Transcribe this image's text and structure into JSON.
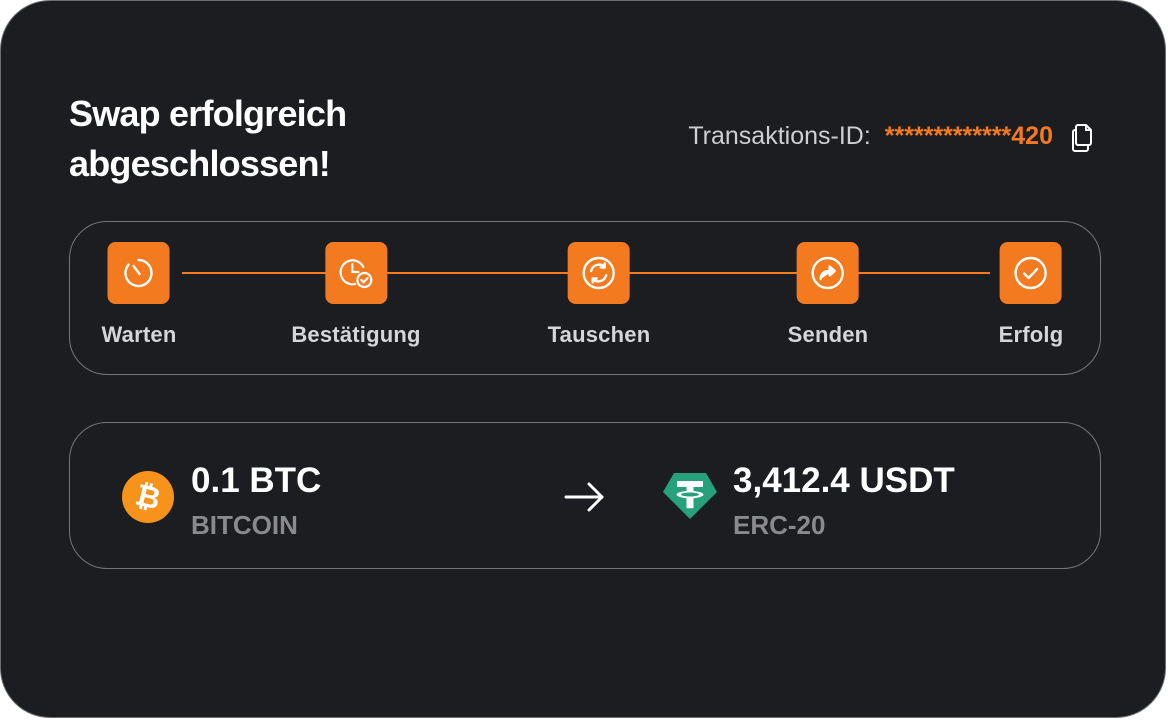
{
  "header": {
    "title_line1": "Swap erfolgreich",
    "title_line2": "abgeschlossen!",
    "transaction_label": "Transaktions-ID:",
    "transaction_id": "*************420"
  },
  "steps": [
    {
      "label": "Warten",
      "icon": "timer-icon"
    },
    {
      "label": "Bestätigung",
      "icon": "clock-check-icon"
    },
    {
      "label": "Tauschen",
      "icon": "swap-cycle-icon"
    },
    {
      "label": "Senden",
      "icon": "forward-arrow-icon"
    },
    {
      "label": "Erfolg",
      "icon": "check-circle-icon"
    }
  ],
  "swap": {
    "from": {
      "amount": "0.1 BTC",
      "network": "BITCOIN",
      "icon": "bitcoin-icon"
    },
    "to": {
      "amount": "3,412.4 USDT",
      "network": "ERC-20",
      "icon": "tether-icon"
    }
  },
  "colors": {
    "accent": "#f47a1f",
    "background": "#1c1d20",
    "bitcoin": "#f7931a",
    "tether": "#26a17b"
  }
}
